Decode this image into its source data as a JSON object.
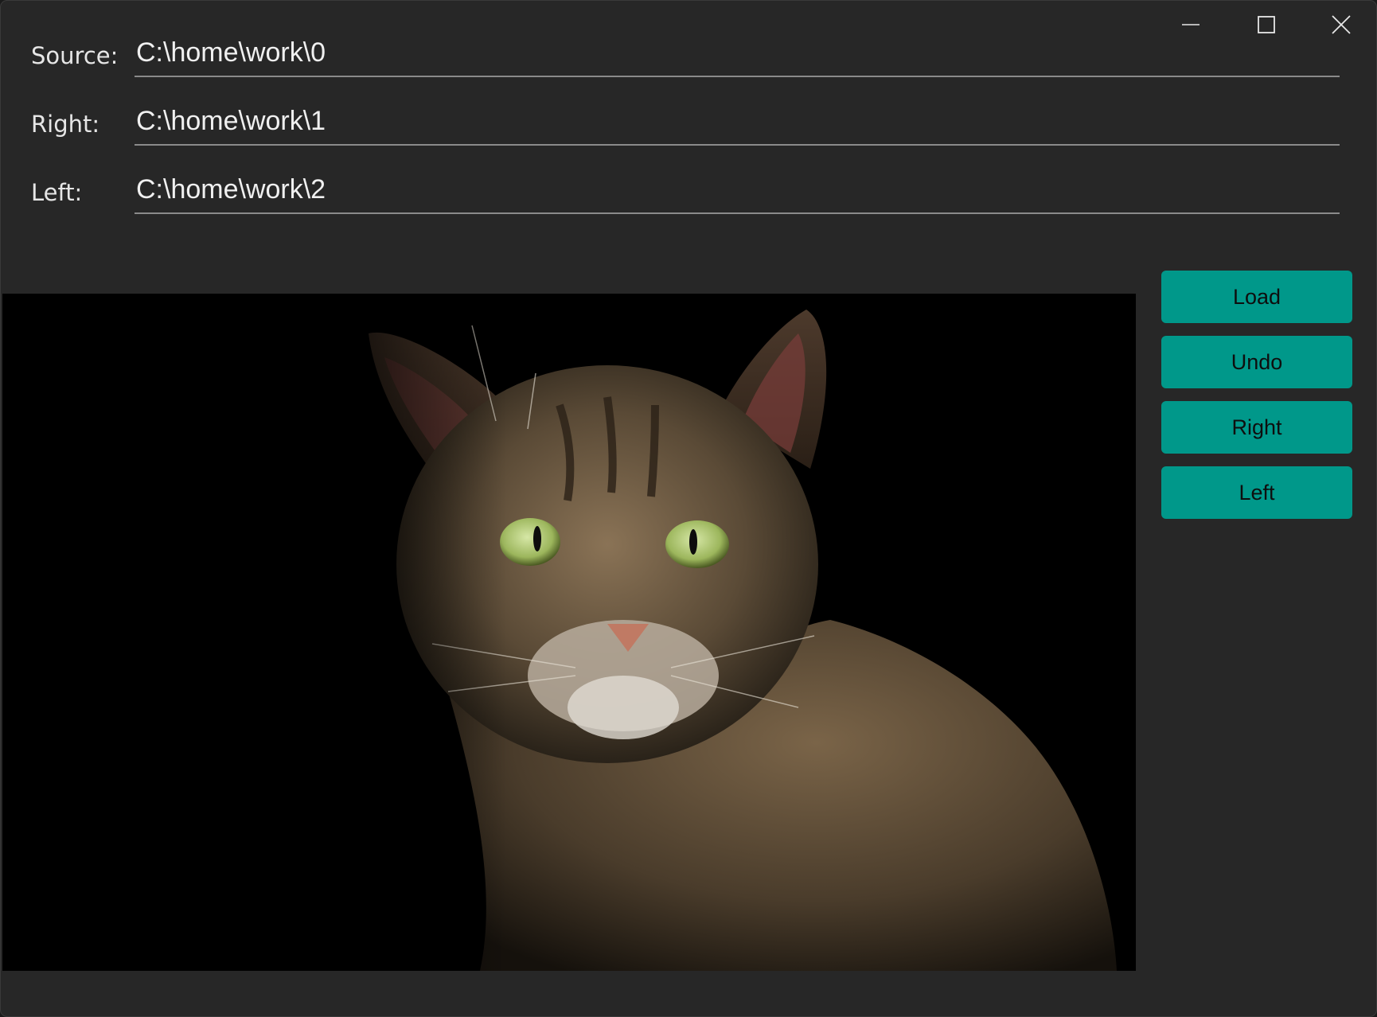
{
  "window": {
    "controls": {
      "minimize_icon": "minimize-icon",
      "maximize_icon": "maximize-icon",
      "close_icon": "close-icon"
    }
  },
  "form": {
    "source": {
      "label": "Source:",
      "value": "C:\\home\\work\\0"
    },
    "right": {
      "label": "Right:",
      "value": "C:\\home\\work\\1"
    },
    "left": {
      "label": "Left:",
      "value": "C:\\home\\work\\2"
    }
  },
  "buttons": {
    "load": "Load",
    "undo": "Undo",
    "right": "Right",
    "left": "Left"
  },
  "colors": {
    "window_background": "#272727",
    "button_accent": "#00988a",
    "image_background": "#000000"
  }
}
